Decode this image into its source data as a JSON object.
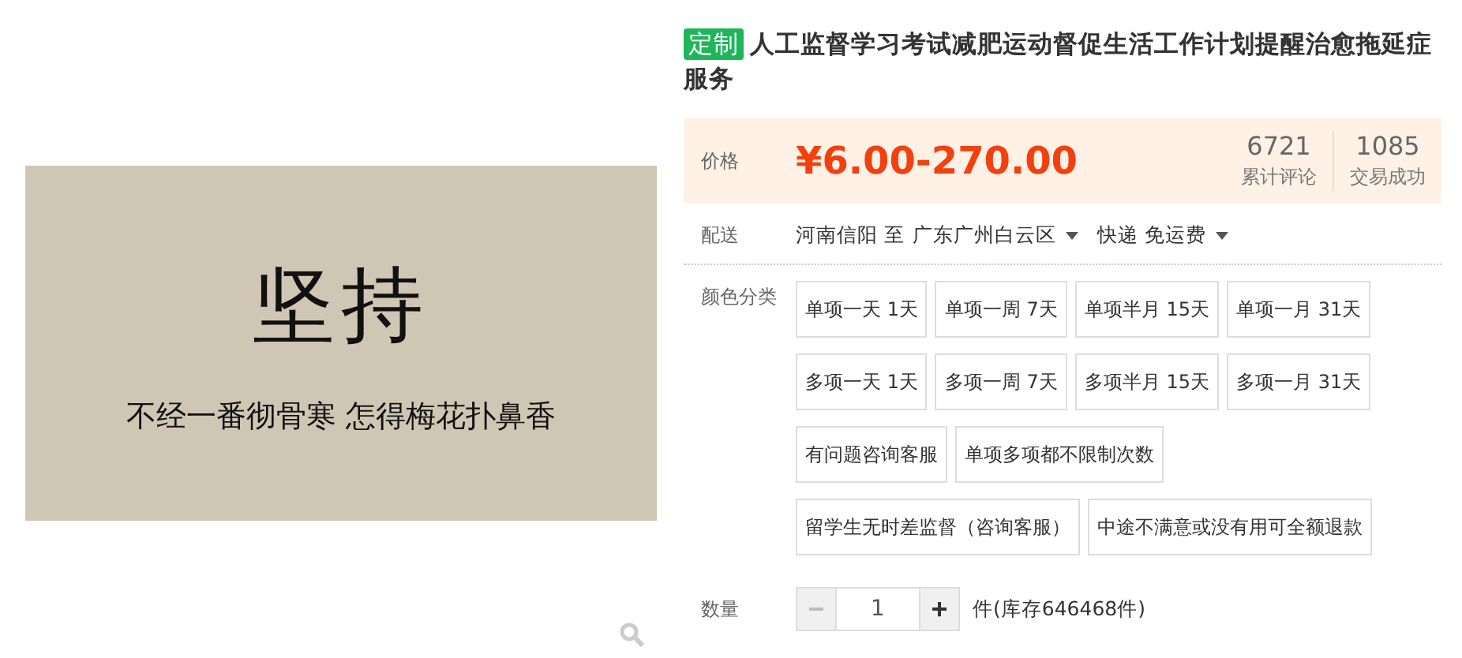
{
  "product_image": {
    "headline": "坚持",
    "subline": "不经一番彻骨寒 怎得梅花扑鼻香"
  },
  "title": {
    "tag": "定制",
    "text": "人工监督学习考试减肥运动督促生活工作计划提醒治愈拖延症服务"
  },
  "price": {
    "label": "价格",
    "value": "¥6.00-270.00",
    "stats": [
      {
        "number": "6721",
        "label": "累计评论"
      },
      {
        "number": "1085",
        "label": "交易成功"
      }
    ]
  },
  "delivery": {
    "label": "配送",
    "from": "河南信阳 至",
    "to": "广东广州白云区",
    "shipping": "快递 免运费"
  },
  "options": {
    "label": "颜色分类",
    "rows": [
      [
        "单项一天 1天",
        "单项一周 7天",
        "单项半月 15天",
        "单项一月 31天"
      ],
      [
        "多项一天 1天",
        "多项一周 7天",
        "多项半月 15天",
        "多项一月 31天"
      ],
      [
        "有问题咨询客服",
        "单项多项都不限制次数"
      ],
      [
        "留学生无时差监督（咨询客服）",
        "中途不满意或没有用可全额退款"
      ]
    ]
  },
  "quantity": {
    "label": "数量",
    "minus": "−",
    "plus": "+",
    "value": "1",
    "minus_disabled": true,
    "stock": "件(库存646468件)"
  }
}
